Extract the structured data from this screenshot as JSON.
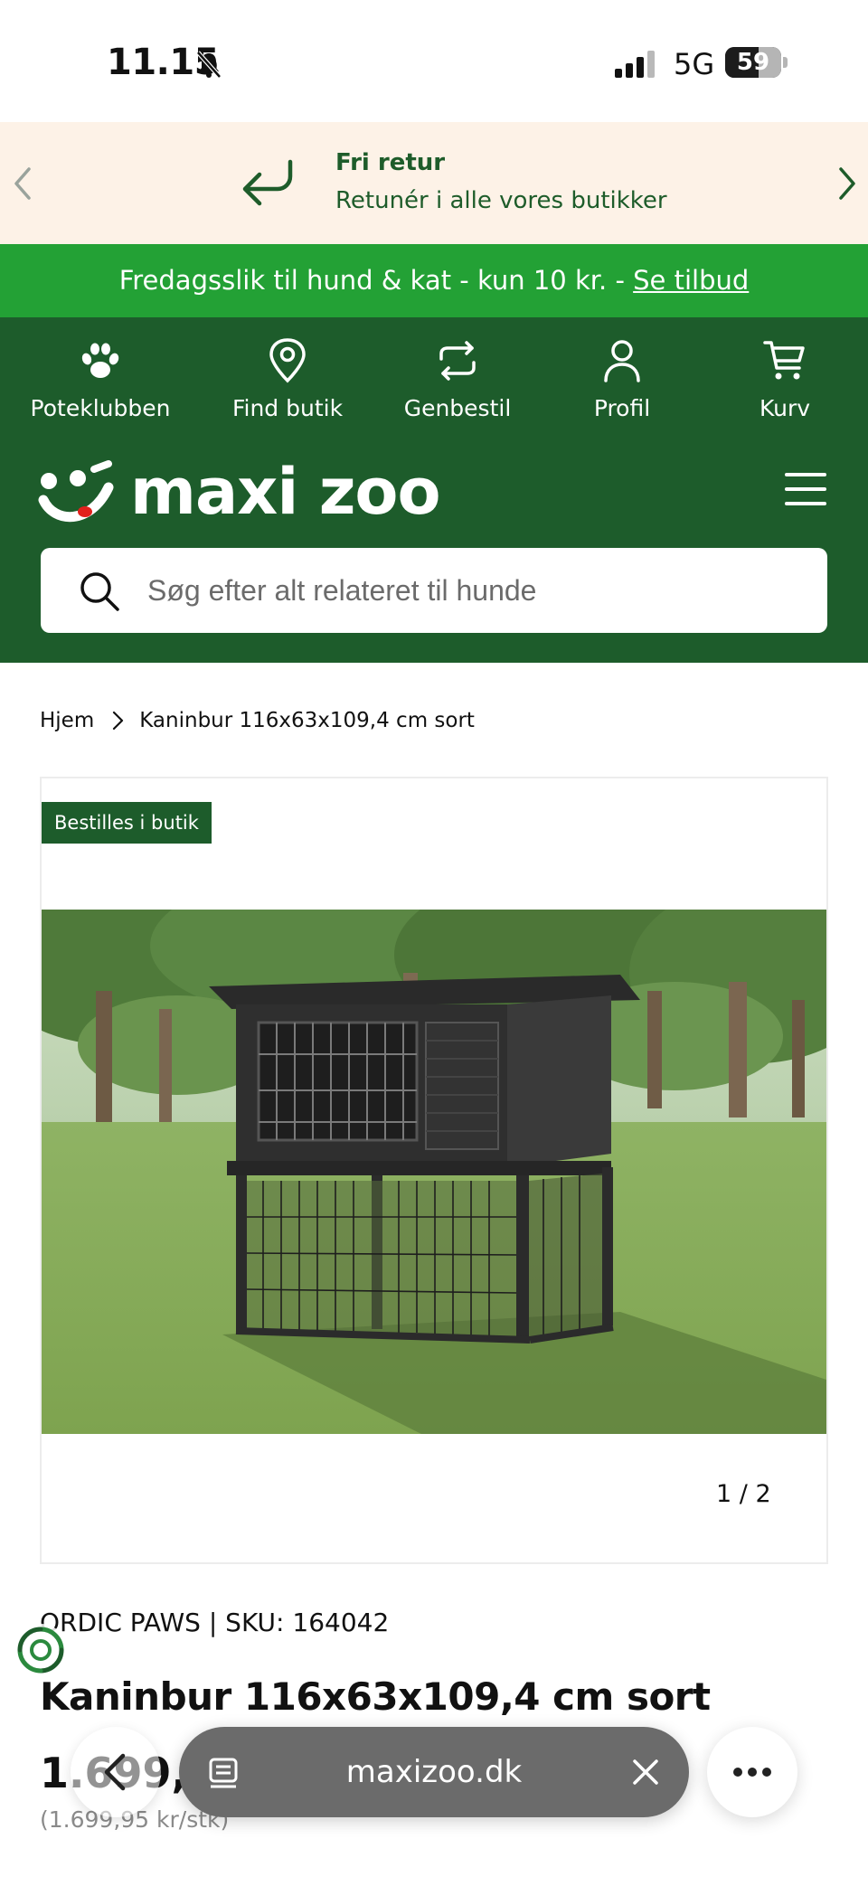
{
  "status_bar": {
    "time": "11.15",
    "network": "5G",
    "battery": "59",
    "battery_level_percent": 59,
    "icons": [
      "bell-slash-icon",
      "signal-icon",
      "battery-icon"
    ]
  },
  "promo": {
    "title": "Fri retur",
    "subtitle": "Retunér i alle vores butikker",
    "icons": [
      "return-arrow-icon",
      "chevron-left-icon",
      "chevron-right-icon"
    ]
  },
  "offer": {
    "text": "Fredagsslik til hund & kat - kun 10 kr. - ",
    "link": "Se tilbud"
  },
  "header": {
    "nav": [
      {
        "label": "Poteklubben",
        "icon": "paw-icon"
      },
      {
        "label": "Find butik",
        "icon": "map-pin-icon"
      },
      {
        "label": "Genbestil",
        "icon": "repeat-icon"
      },
      {
        "label": "Profil",
        "icon": "user-icon"
      },
      {
        "label": "Kurv",
        "icon": "cart-icon"
      }
    ],
    "logo_text": "maxi zoo",
    "menu_icon": "hamburger-menu-icon",
    "search": {
      "placeholder": "Søg efter alt relateret til hunde",
      "value": ""
    }
  },
  "breadcrumb": {
    "home": "Hjem",
    "current": "Kaninbur 116x63x109,4 cm sort"
  },
  "product": {
    "badge": "Bestilles i butik",
    "image_counter": "1 / 2",
    "brand_sku": "ORDIC PAWS | SKU: 164042",
    "title": "Kaninbur 116x63x109,4 cm sort",
    "price": "1.699,95",
    "unit_price": "(1.699,95 kr/stk)"
  },
  "browser": {
    "url": "maxizoo.dk",
    "icons": [
      "back-arrow-icon",
      "tabs-icon",
      "close-icon",
      "more-dots-icon"
    ]
  },
  "colors": {
    "brand_green": "#1d5c2b",
    "offer_green": "#23a135",
    "promo_bg": "#fdf2e7"
  }
}
